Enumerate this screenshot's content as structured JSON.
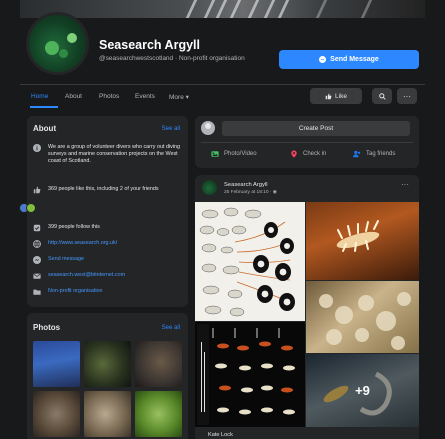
{
  "page": {
    "name": "Seasearch Argyll",
    "subtitle": "@seasearchwestscotland · Non-profit organisation",
    "send_message_label": "Send Message"
  },
  "tabs": [
    {
      "label": "Home",
      "active": true
    },
    {
      "label": "About"
    },
    {
      "label": "Photos"
    },
    {
      "label": "Events"
    },
    {
      "label": "More ▾"
    }
  ],
  "actions": {
    "like_label": "Like",
    "search_icon": "search-icon",
    "more_icon": "more-dots-icon"
  },
  "about": {
    "title": "About",
    "see_all": "See all",
    "description": "We are a group of volunteer divers who carry out diving surveys and marine conservation projects on the West coast of Scotland.",
    "likes": "369 people like this, including 2 of your friends",
    "follows": "399 people follow this",
    "website": "http://www.seasearch.org.uk/",
    "send_message": "Send message",
    "email": "seasearch.west@btinternet.com",
    "category": "Non-profit organisation"
  },
  "photos": {
    "title": "Photos",
    "see_all": "See all"
  },
  "composer": {
    "create_post": "Create Post",
    "photo_video": "Photo/Video",
    "check_in": "Check in",
    "tag_friends": "Tag friends"
  },
  "post": {
    "author": "Seasearch Argyll",
    "time": "25 February at 18:10 · ",
    "more_photos": "+9",
    "commenter": "Kate Lock"
  },
  "colors": {
    "accent": "#2d88ff",
    "background": "#18191a",
    "card": "#242526"
  }
}
